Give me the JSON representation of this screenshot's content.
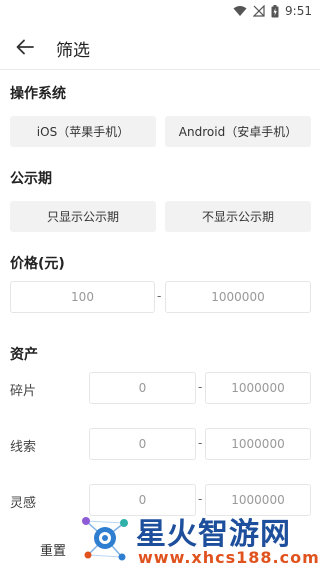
{
  "status_bar": {
    "time": "9:51"
  },
  "header": {
    "title": "筛选"
  },
  "os_section": {
    "title": "操作系统",
    "options": [
      "iOS（苹果手机）",
      "Android（安卓手机）"
    ]
  },
  "publicity_section": {
    "title": "公示期",
    "options": [
      "只显示公示期",
      "不显示公示期"
    ]
  },
  "price_section": {
    "title": "价格(元)",
    "min_placeholder": "100",
    "separator": "-",
    "max_placeholder": "1000000"
  },
  "assets_section": {
    "title": "资产",
    "rows": [
      {
        "label": "碎片",
        "min": "0",
        "max": "1000000"
      },
      {
        "label": "线索",
        "min": "0",
        "max": "1000000"
      },
      {
        "label": "灵感",
        "min": "0",
        "max": "1000000"
      }
    ]
  },
  "footer": {
    "reset_label": "重置"
  },
  "watermark": {
    "title": "星火智游网",
    "url": "www.xhcs188.com"
  },
  "colors": {
    "accent_blue": "#1e4f9c",
    "accent_orange": "#e0531f",
    "button_bg": "#f2f2f2"
  }
}
